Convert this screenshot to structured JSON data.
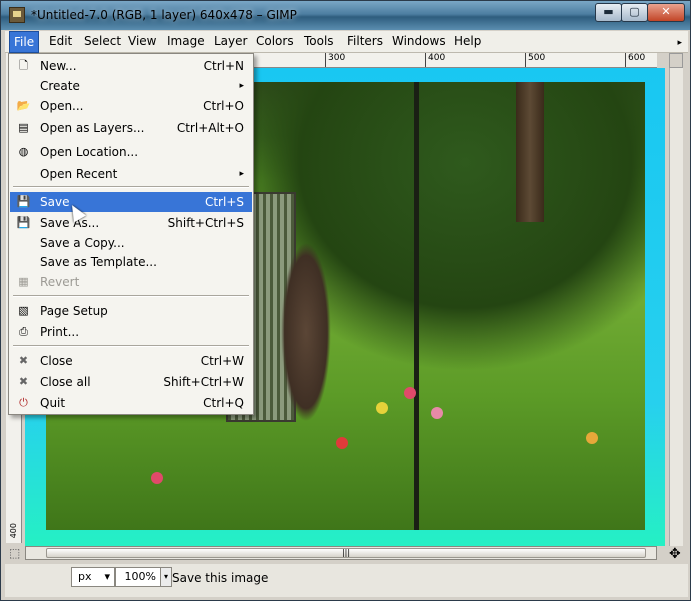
{
  "window": {
    "title": "*Untitled-7.0 (RGB, 1 layer) 640x478 – GIMP",
    "min_glyph": "▬",
    "max_glyph": "▢",
    "close_glyph": "✕"
  },
  "menubar": {
    "items": [
      "File",
      "Edit",
      "Select",
      "View",
      "Image",
      "Layer",
      "Colors",
      "Tools",
      "Filters",
      "Windows",
      "Help"
    ],
    "active": "File",
    "overflow_arrow": "▸"
  },
  "ruler": {
    "h_labels": [
      "300",
      "400",
      "500",
      "600"
    ],
    "v_label": "400"
  },
  "file_menu": {
    "items": [
      {
        "label": "New...",
        "accel": "Ctrl+N",
        "icon": "new-file-icon"
      },
      {
        "label": "Create",
        "submenu": true,
        "accel": "▸"
      },
      {
        "label": "Open...",
        "accel": "Ctrl+O",
        "icon": "folder-icon"
      },
      {
        "label": "Open as Layers...",
        "accel": "Ctrl+Alt+O",
        "icon": "layers-icon"
      },
      {
        "label": "Open Location...",
        "accel": "",
        "icon": "globe-icon"
      },
      {
        "label": "Open Recent",
        "submenu": true,
        "accel": "▸"
      },
      {
        "label": "Save",
        "accel": "Ctrl+S",
        "icon": "floppy-icon",
        "selected": true
      },
      {
        "label": "Save As...",
        "accel": "Shift+Ctrl+S",
        "icon": "floppy-as-icon"
      },
      {
        "label": "Save a Copy...",
        "accel": ""
      },
      {
        "label": "Save as Template...",
        "accel": ""
      },
      {
        "label": "Revert",
        "accel": "",
        "icon": "revert-icon",
        "disabled": true
      },
      {
        "label": "Page Setup",
        "accel": "",
        "icon": "page-setup-icon"
      },
      {
        "label": "Print...",
        "accel": "",
        "icon": "printer-icon"
      },
      {
        "label": "Close",
        "accel": "Ctrl+W",
        "icon": "close-x-icon"
      },
      {
        "label": "Close all",
        "accel": "Shift+Ctrl+W",
        "icon": "close-all-icon"
      },
      {
        "label": "Quit",
        "accel": "Ctrl+Q",
        "icon": "quit-icon"
      }
    ]
  },
  "statusbar": {
    "unit": "px",
    "zoom": "100%",
    "message": "Save this image",
    "combo_arrow": "▾"
  },
  "scroll": {
    "grip": "|||"
  },
  "colors": {
    "menu_highlight": "#3875d7",
    "canvas_border": "#19c7f2"
  }
}
